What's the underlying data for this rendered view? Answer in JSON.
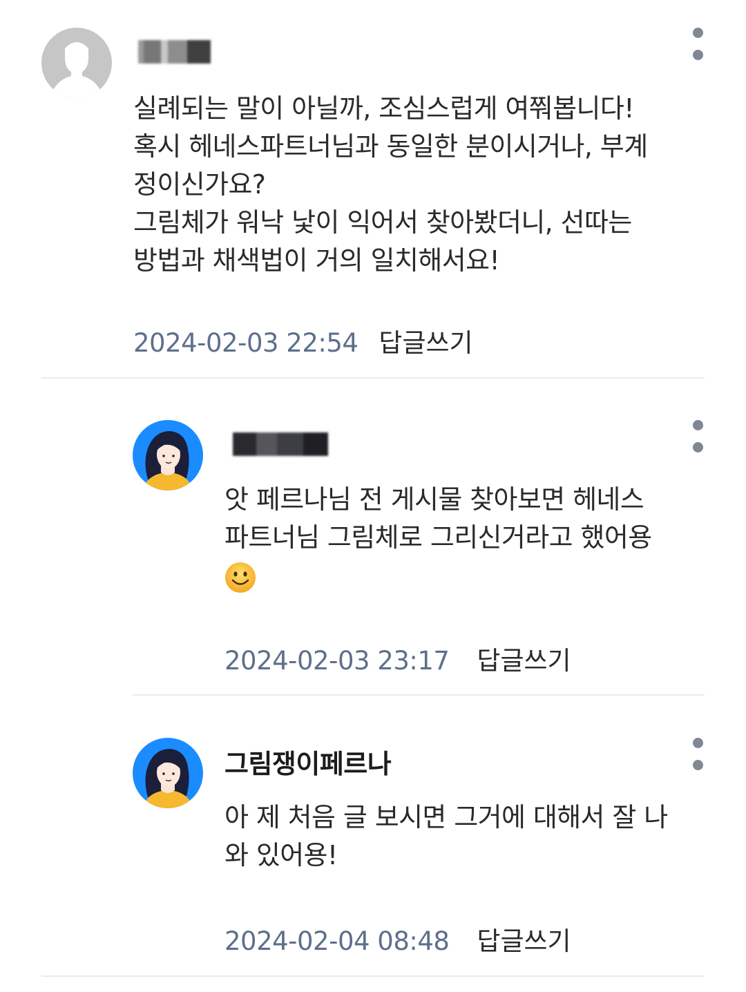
{
  "comments": [
    {
      "author": "",
      "author_redacted": true,
      "avatar_icon": "default-profile-icon",
      "lines": [
        "실례되는 말이 아닐까, 조심스럽게 여쭤봅니다!",
        "혹시 헤네스파트너님과 동일한 분이시거나, 부계",
        "정이신가요?",
        "그림체가 워낙 낯이 익어서 찾아봤더니, 선따는",
        "방법과 채색법이 거의 일치해서요!"
      ],
      "timestamp": "2024-02-03 22:54",
      "reply_label": "답글쓰기"
    },
    {
      "author": "",
      "author_redacted": true,
      "avatar_icon": "girl-avatar-icon",
      "lines": [
        "앗 페르나님 전 게시물 찾아보면 헤네스",
        "파트너님 그림체로 그리신거라고 했어용"
      ],
      "emoji": "smiling-face-emoji",
      "timestamp": "2024-02-03 23:17",
      "reply_label": "답글쓰기"
    },
    {
      "author": "그림쟁이페르나",
      "author_redacted": false,
      "avatar_icon": "girl-avatar-icon",
      "lines": [
        "아 제 처음 글 보시면 그거에 대해서 잘 나",
        "와 있어용!"
      ],
      "timestamp": "2024-02-04 08:48",
      "reply_label": "답글쓰기"
    }
  ],
  "colors": {
    "timestamp": "#5d6f8c",
    "more_icon": "#7f8893",
    "avatar_bg": "#1a8cff",
    "divider": "#ebebeb"
  }
}
